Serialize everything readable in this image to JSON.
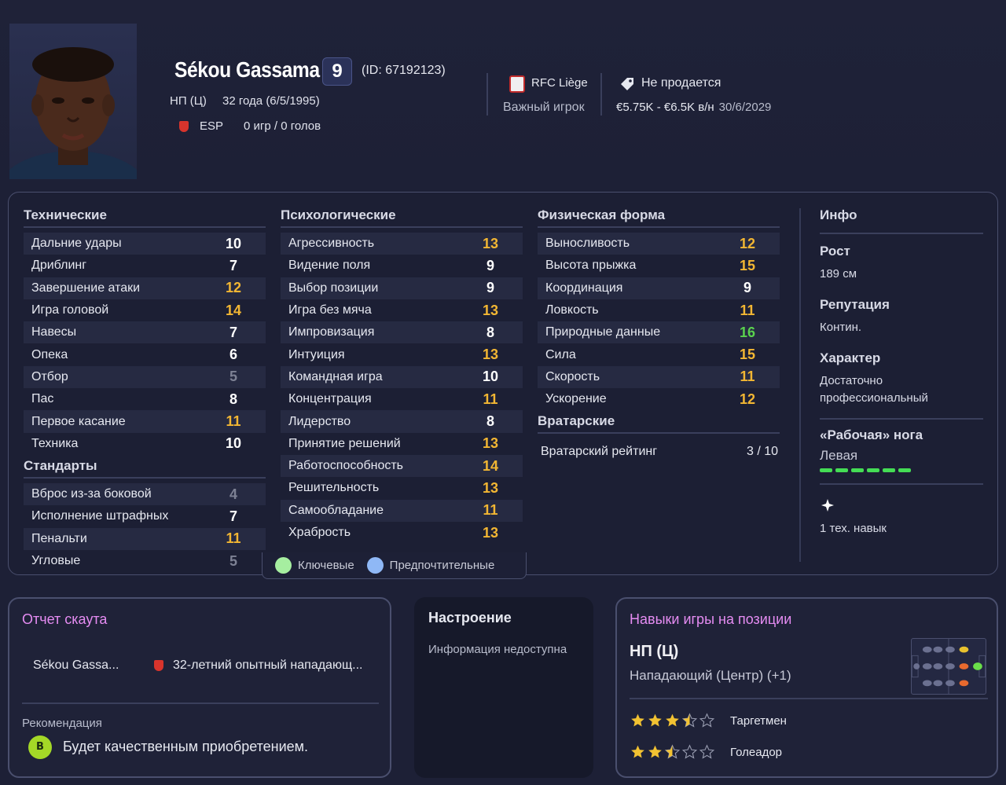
{
  "player": {
    "name": "Sékou Gassama",
    "number": "9",
    "id_text": "(ID: 67192123)",
    "position": "НП (Ц)",
    "age_text": "32 года (6/5/1995)",
    "nation_code": "ESP",
    "caps_text": "0 игр / 0 голов"
  },
  "club": {
    "name": "RFC Liège",
    "status": "Важный игрок"
  },
  "transfer": {
    "status": "Не продается",
    "wage": "€5.75K - €6.5K в/н",
    "contract_end": "30/6/2029"
  },
  "technical": {
    "title": "Технические",
    "items": [
      {
        "label": "Дальние удары",
        "value": "10",
        "tone": "white"
      },
      {
        "label": "Дриблинг",
        "value": "7",
        "tone": "white"
      },
      {
        "label": "Завершение атаки",
        "value": "12",
        "tone": "yellow"
      },
      {
        "label": "Игра головой",
        "value": "14",
        "tone": "yellow"
      },
      {
        "label": "Навесы",
        "value": "7",
        "tone": "white"
      },
      {
        "label": "Опека",
        "value": "6",
        "tone": "white"
      },
      {
        "label": "Отбор",
        "value": "5",
        "tone": "grey"
      },
      {
        "label": "Пас",
        "value": "8",
        "tone": "white"
      },
      {
        "label": "Первое касание",
        "value": "11",
        "tone": "yellow"
      },
      {
        "label": "Техника",
        "value": "10",
        "tone": "white"
      }
    ]
  },
  "set_pieces": {
    "title": "Стандарты",
    "items": [
      {
        "label": "Вброс из-за боковой",
        "value": "4",
        "tone": "grey"
      },
      {
        "label": "Исполнение штрафных",
        "value": "7",
        "tone": "white"
      },
      {
        "label": "Пенальти",
        "value": "11",
        "tone": "yellow"
      },
      {
        "label": "Угловые",
        "value": "5",
        "tone": "grey"
      }
    ]
  },
  "mental": {
    "title": "Психологические",
    "items": [
      {
        "label": "Агрессивность",
        "value": "13",
        "tone": "yellow"
      },
      {
        "label": "Видение поля",
        "value": "9",
        "tone": "white"
      },
      {
        "label": "Выбор позиции",
        "value": "9",
        "tone": "white"
      },
      {
        "label": "Игра без мяча",
        "value": "13",
        "tone": "yellow"
      },
      {
        "label": "Импровизация",
        "value": "8",
        "tone": "white"
      },
      {
        "label": "Интуиция",
        "value": "13",
        "tone": "yellow"
      },
      {
        "label": "Командная игра",
        "value": "10",
        "tone": "white"
      },
      {
        "label": "Концентрация",
        "value": "11",
        "tone": "yellow"
      },
      {
        "label": "Лидерство",
        "value": "8",
        "tone": "white"
      },
      {
        "label": "Принятие решений",
        "value": "13",
        "tone": "yellow"
      },
      {
        "label": "Работоспособность",
        "value": "14",
        "tone": "yellow"
      },
      {
        "label": "Решительность",
        "value": "13",
        "tone": "yellow"
      },
      {
        "label": "Самообладание",
        "value": "11",
        "tone": "yellow"
      },
      {
        "label": "Храбрость",
        "value": "13",
        "tone": "yellow"
      }
    ]
  },
  "physical": {
    "title": "Физическая форма",
    "items": [
      {
        "label": "Выносливость",
        "value": "12",
        "tone": "yellow"
      },
      {
        "label": "Высота прыжка",
        "value": "15",
        "tone": "yellow"
      },
      {
        "label": "Координация",
        "value": "9",
        "tone": "white"
      },
      {
        "label": "Ловкость",
        "value": "11",
        "tone": "yellow"
      },
      {
        "label": "Природные данные",
        "value": "16",
        "tone": "green"
      },
      {
        "label": "Сила",
        "value": "15",
        "tone": "yellow"
      },
      {
        "label": "Скорость",
        "value": "11",
        "tone": "yellow"
      },
      {
        "label": "Ускорение",
        "value": "12",
        "tone": "yellow"
      }
    ]
  },
  "goalkeeping": {
    "title": "Вратарские",
    "label": "Вратарский рейтинг",
    "value": "3 / 10"
  },
  "legend": {
    "key": "Ключевые",
    "preferred": "Предпочтительные"
  },
  "info": {
    "title": "Инфо",
    "height_label": "Рост",
    "height_value": "189 см",
    "reputation_label": "Репутация",
    "reputation_value": "Контин.",
    "personality_label": "Характер",
    "personality_value": "Достаточно профессиональный",
    "foot_label": "«Рабочая» нога",
    "foot_value": "Левая",
    "skills_text": "1 тех. навык"
  },
  "scout": {
    "title": "Отчет скаута",
    "player_short": "Sékou Gassa...",
    "description": "32-летний опытный нападающ...",
    "rec_label": "Рекомендация",
    "rec_grade": "B",
    "rec_text": "Будет качественным приобретением."
  },
  "mood": {
    "title": "Настроение",
    "text": "Информация недоступна"
  },
  "roles": {
    "title": "Навыки игры на позиции",
    "position_code": "НП (Ц)",
    "position_name": "Нападающий (Центр) (+1)",
    "items": [
      {
        "name": "Таргетмен",
        "stars": 3.5
      },
      {
        "name": "Голеадор",
        "stars": 2.5
      }
    ]
  },
  "colors": {
    "yellow": "#f2b633",
    "green": "#5ad24e",
    "grey": "#7d8194",
    "white": "#ffffff",
    "accent_pink": "#e58cf2"
  }
}
